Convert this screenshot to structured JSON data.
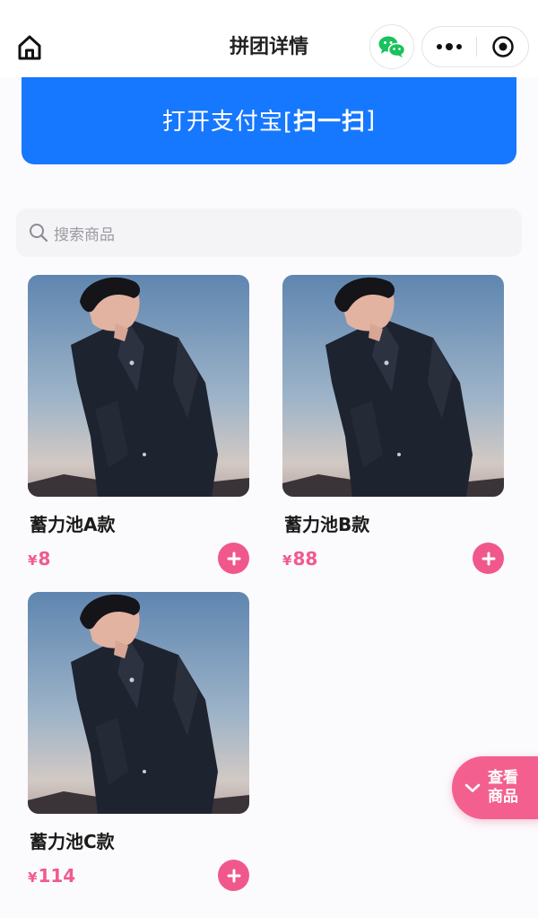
{
  "navbar": {
    "title": "拼团详情",
    "home_icon": "home-icon",
    "wechat_icon": "wechat-icon",
    "more_icon": "more-dots-icon",
    "close_icon": "close-circle-icon"
  },
  "banner": {
    "prefix": "打开支付宝[",
    "action": "扫一扫",
    "suffix": "]",
    "color": "#1677ff"
  },
  "search": {
    "placeholder": "搜索商品",
    "icon": "search-icon"
  },
  "products": [
    {
      "title": "蓄力池A款",
      "currency": "¥",
      "price": "8"
    },
    {
      "title": "蓄力池B款",
      "currency": "¥",
      "price": "88"
    },
    {
      "title": "蓄力池C款",
      "currency": "¥",
      "price": "114"
    }
  ],
  "float_button": {
    "line1": "查看",
    "line2": "商品",
    "icon": "chevron-down-icon"
  },
  "colors": {
    "accent_pink": "#f0588c",
    "primary_blue": "#1677ff"
  }
}
